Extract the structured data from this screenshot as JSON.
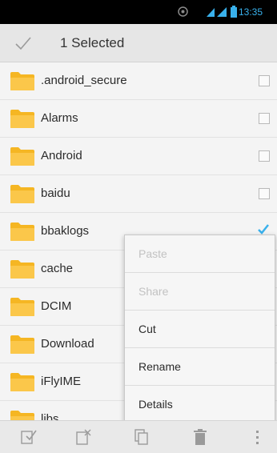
{
  "status_bar": {
    "time": "13:35",
    "icons": [
      "wifi-icon",
      "signal-icon",
      "battery-icon"
    ],
    "time_color": "#39b1ec"
  },
  "action_bar": {
    "title": "1 Selected",
    "icon": "check-icon"
  },
  "files": [
    {
      "name": ".android_secure",
      "checked": false
    },
    {
      "name": "Alarms",
      "checked": false
    },
    {
      "name": "Android",
      "checked": false
    },
    {
      "name": "baidu",
      "checked": false
    },
    {
      "name": "bbaklogs",
      "checked": true
    },
    {
      "name": "cache",
      "checked": false
    },
    {
      "name": "DCIM",
      "checked": false
    },
    {
      "name": "Download",
      "checked": false
    },
    {
      "name": "iFlyIME",
      "checked": false
    },
    {
      "name": "libs",
      "checked": false
    }
  ],
  "context_menu": [
    {
      "label": "Paste",
      "enabled": false
    },
    {
      "label": "Share",
      "enabled": false
    },
    {
      "label": "Cut",
      "enabled": true
    },
    {
      "label": "Rename",
      "enabled": true
    },
    {
      "label": "Details",
      "enabled": true
    }
  ],
  "bottom_bar": {
    "icons": [
      "select-all-icon",
      "deselect-all-icon",
      "copy-icon",
      "delete-icon",
      "overflow-menu-icon"
    ]
  },
  "colors": {
    "accent": "#39b1ec",
    "folder": "#f5b623"
  }
}
